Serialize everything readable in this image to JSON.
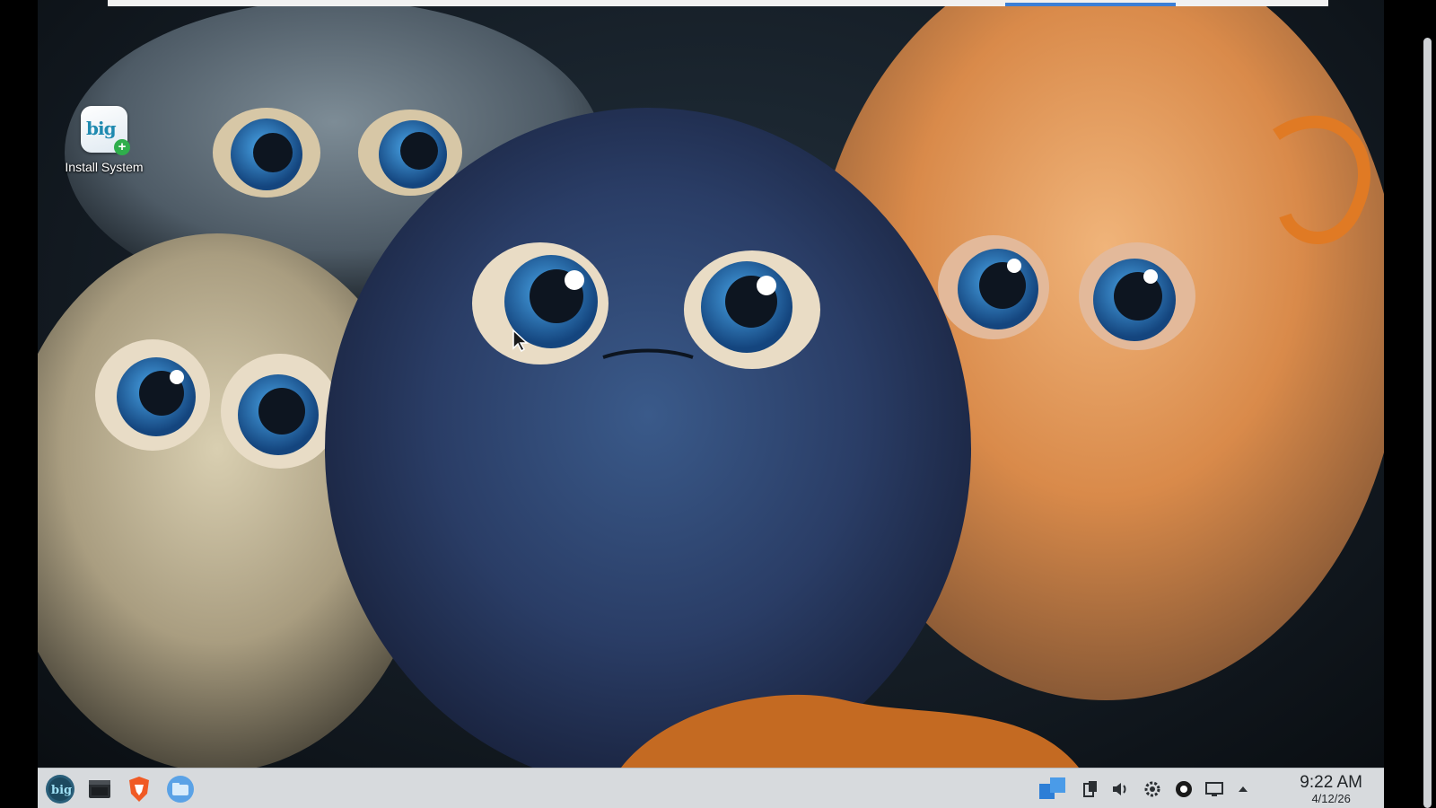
{
  "desktop": {
    "icons": [
      {
        "label": "Install System",
        "glyph_text": "big"
      }
    ]
  },
  "taskbar": {
    "launchers": [
      {
        "name": "app-menu-icon"
      },
      {
        "name": "terminal-icon"
      },
      {
        "name": "brave-browser-icon"
      },
      {
        "name": "file-manager-icon"
      }
    ],
    "tray": [
      {
        "name": "task-switcher-icon"
      },
      {
        "name": "clipboard-icon"
      },
      {
        "name": "volume-icon"
      },
      {
        "name": "settings-gear-icon"
      },
      {
        "name": "record-icon"
      },
      {
        "name": "display-icon"
      },
      {
        "name": "expand-tray-arrow-icon"
      }
    ],
    "clock": {
      "time": "9:22 AM",
      "date": "4/12/26"
    }
  },
  "colors": {
    "taskbar_bg": "#d7dadd",
    "accent": "#3c7fd6",
    "brave": "#f05a24",
    "install_badge": "#2fae4c"
  }
}
